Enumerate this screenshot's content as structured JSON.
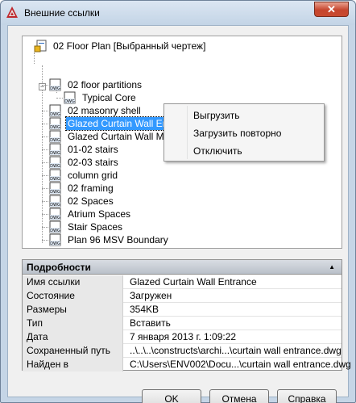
{
  "window": {
    "title": "Внешние ссылки",
    "close_label": "✕"
  },
  "tree": {
    "root": "02 Floor Plan [Выбранный чертеж]",
    "items": [
      {
        "label": "02 floor partitions"
      },
      {
        "label": "Typical Core"
      },
      {
        "label": "02 masonry shell"
      },
      {
        "label": "Glazed Curtain Wall Entrance"
      },
      {
        "label": "Glazed Curtain Wall Main"
      },
      {
        "label": "01-02 stairs"
      },
      {
        "label": "02-03 stairs"
      },
      {
        "label": "column grid"
      },
      {
        "label": "02 framing"
      },
      {
        "label": "02 Spaces"
      },
      {
        "label": "Atrium Spaces"
      },
      {
        "label": "Stair Spaces"
      },
      {
        "label": "Plan 96 MSV Boundary"
      }
    ],
    "icon_text": "DWG",
    "expander_glyph": "−"
  },
  "context_menu": {
    "items": [
      {
        "label": "Выгрузить"
      },
      {
        "label": "Загрузить повторно"
      },
      {
        "label": "Отключить"
      }
    ]
  },
  "details": {
    "header": "Подробности",
    "collapse_glyph": "▲",
    "rows": [
      {
        "key": "Имя ссылки",
        "value": "Glazed Curtain Wall Entrance"
      },
      {
        "key": "Состояние",
        "value": "Загружен"
      },
      {
        "key": "Размеры",
        "value": "354KB"
      },
      {
        "key": "Тип",
        "value": "Вставить"
      },
      {
        "key": "Дата",
        "value": "7 января 2013 г.   1:09:22"
      },
      {
        "key": "Сохраненный путь",
        "value": "..\\..\\..\\constructs\\archi...\\curtain wall entrance.dwg"
      },
      {
        "key": "Найден в",
        "value": "C:\\Users\\ENV002\\Docu...\\curtain wall entrance.dwg"
      }
    ]
  },
  "buttons": {
    "ok": "OK",
    "cancel": "Отмена",
    "help": "Справка"
  },
  "colors": {
    "selection": "#3399ff",
    "close": "#c6452e",
    "brand": "#c0282d"
  }
}
